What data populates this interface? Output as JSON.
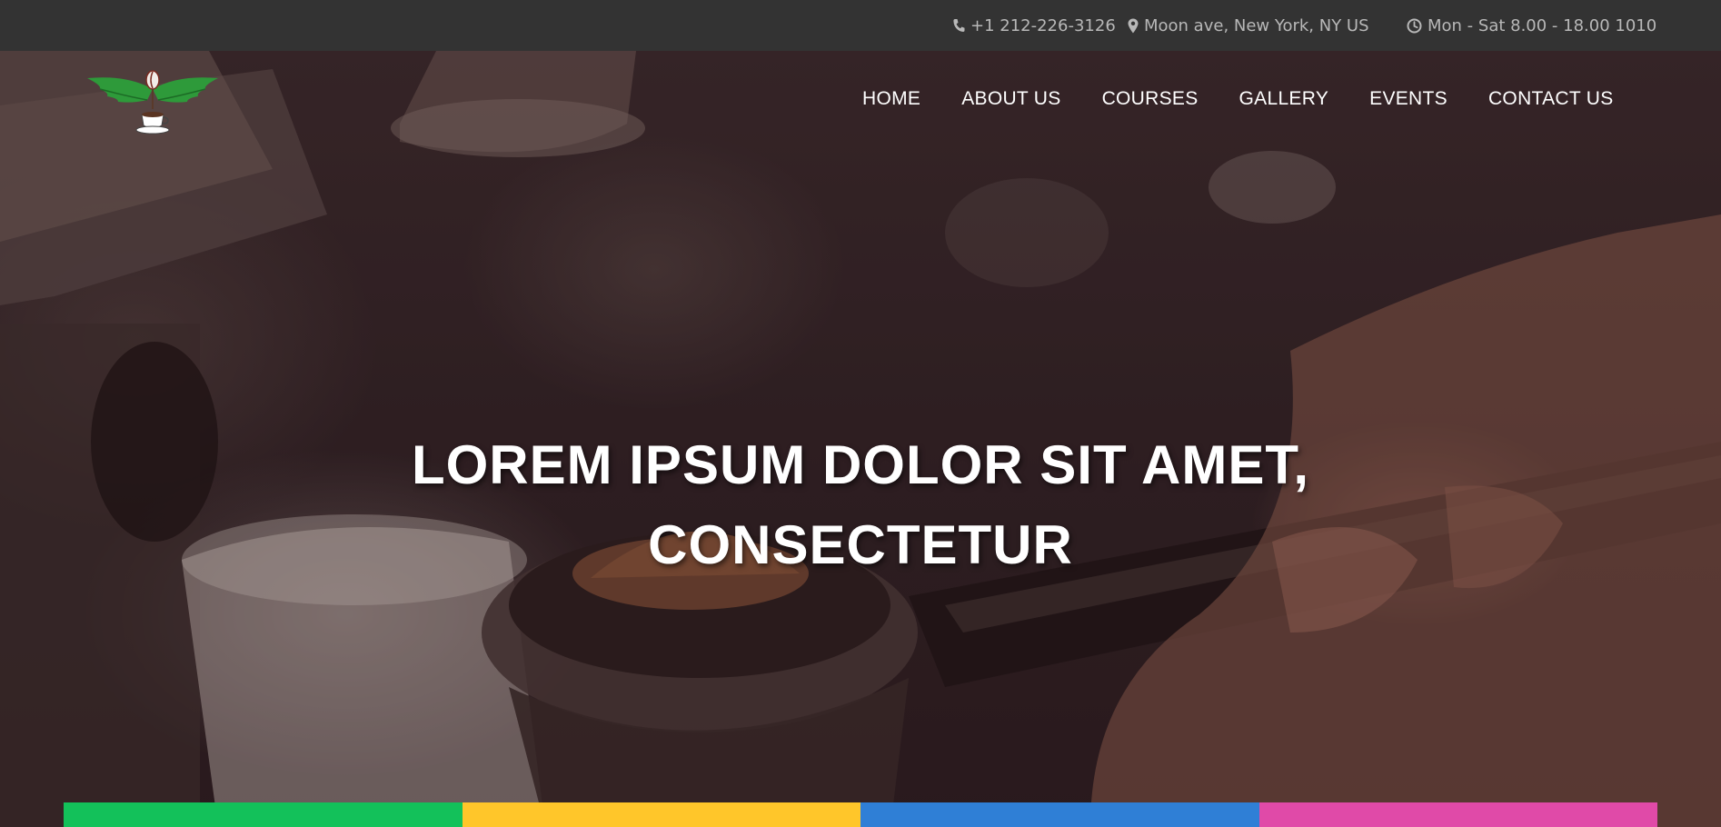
{
  "topbar": {
    "phone": "+1 212-226-3126",
    "address": "Moon ave, New York, NY US",
    "hours": "Mon - Sat 8.00 - 18.00 1010",
    "icons": [
      "phone-icon",
      "map-marker-icon",
      "clock-icon"
    ]
  },
  "nav": {
    "items": [
      {
        "label": "HOME"
      },
      {
        "label": "ABOUT US"
      },
      {
        "label": "COURSES"
      },
      {
        "label": "GALLERY"
      },
      {
        "label": "EVENTS"
      },
      {
        "label": "CONTACT US"
      }
    ]
  },
  "hero": {
    "line1": "LOREM IPSUM DOLOR SIT AMET,",
    "line2": "CONSECTETUR"
  },
  "colors": {
    "topbar_bg": "#333333",
    "strip": [
      "#13c15a",
      "#ffc62a",
      "#2f7fd6",
      "#e04aa8"
    ]
  }
}
